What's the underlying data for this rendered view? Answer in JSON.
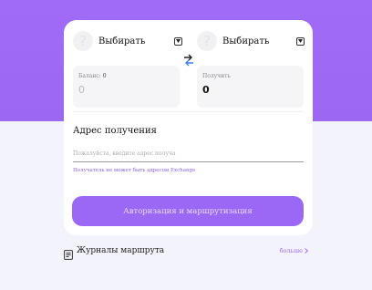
{
  "colors": {
    "accent": "#9a68f5",
    "header_background": "#a06cf7",
    "page_background": "#f3f3fb"
  },
  "from_token": {
    "select_label": "Выбирать",
    "icon": "placeholder-token-logo",
    "amount_label": "Баланс:",
    "balance": "0",
    "amount_value": "0"
  },
  "to_token": {
    "select_label": "Выбирать",
    "icon": "placeholder-token-logo",
    "amount_label": "Получить",
    "amount_value": "0"
  },
  "swap": {
    "icon": "swap-arrows-icon"
  },
  "recipient": {
    "title": "Адрес получения",
    "placeholder": "Пожалуйста, введите адрес получа",
    "value": "",
    "note": "Получатель не может быть адресом Exchange"
  },
  "submit": {
    "label": "Авторизация и маршрутизация"
  },
  "history": {
    "icon": "journal-icon",
    "title": "Журналы маршрута",
    "more_label": "больше"
  }
}
